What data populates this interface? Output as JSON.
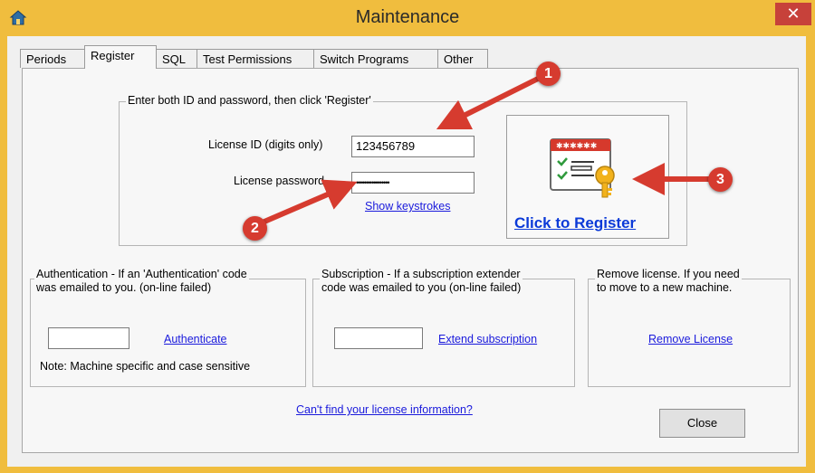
{
  "window": {
    "title": "Maintenance",
    "close_symbol": "✕",
    "app_icon": "home-icon",
    "title_bar_color": "#f0bd3e"
  },
  "tabs": [
    {
      "label": "Periods"
    },
    {
      "label": "Register",
      "active": true
    },
    {
      "label": "SQL"
    },
    {
      "label": "Test Permissions"
    },
    {
      "label": "Switch Programs"
    },
    {
      "label": "Other"
    }
  ],
  "register_group": {
    "caption": "Enter both ID and password, then click 'Register'",
    "license_id_label": "License ID (digits only)",
    "license_id_value": "123456789",
    "password_label": "License password",
    "password_value": "•••••••••••••••••",
    "show_keystrokes": "Show keystrokes",
    "register_button": "Click to Register",
    "register_icon": "license-key-icon"
  },
  "auth_group": {
    "caption_line1": "Authentication - If an 'Authentication' code",
    "caption_line2": "was emailed to you. (on-line failed)",
    "input_value": "",
    "link": "Authenticate",
    "note": "Note: Machine specific and case sensitive"
  },
  "subscription_group": {
    "caption_line1": "Subscription - If a subscription extender",
    "caption_line2": "code was emailed to you (on-line failed)",
    "input_value": "",
    "link": "Extend subscription"
  },
  "remove_group": {
    "caption_line1": "Remove license.  If you need",
    "caption_line2": "to move to a new machine.",
    "link": "Remove License"
  },
  "footer": {
    "help_link": "Can't find your license information?",
    "close_button": "Close"
  },
  "annotations": {
    "badge1": "1",
    "badge2": "2",
    "badge3": "3",
    "arrow_color": "#d63b2f"
  }
}
